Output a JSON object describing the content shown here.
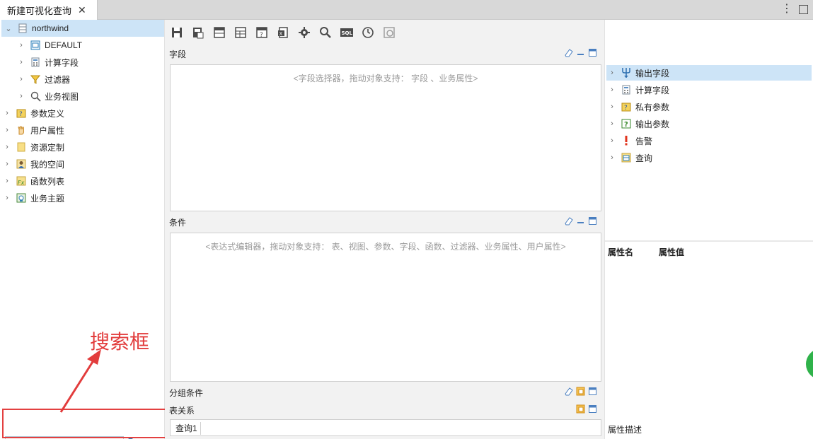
{
  "tabs": [
    {
      "label": "新建可视化查询",
      "close": "✕"
    }
  ],
  "window_controls": {
    "menu": "⋮"
  },
  "left_tree": {
    "root": {
      "label": "northwind",
      "icon": "database-icon"
    },
    "children": [
      {
        "label": "DEFAULT",
        "icon": "table-icon"
      },
      {
        "label": "计算字段",
        "icon": "calculator-icon"
      },
      {
        "label": "过滤器",
        "icon": "filter-icon"
      },
      {
        "label": "业务视图",
        "icon": "search-view-icon"
      }
    ],
    "top_level": [
      {
        "label": "参数定义",
        "icon": "parameter-icon"
      },
      {
        "label": "用户属性",
        "icon": "user-attribute-icon"
      },
      {
        "label": "资源定制",
        "icon": "folder-icon"
      },
      {
        "label": "我的空间",
        "icon": "user-space-icon"
      },
      {
        "label": "函数列表",
        "icon": "function-icon"
      },
      {
        "label": "业务主题",
        "icon": "business-theme-icon"
      }
    ]
  },
  "search": {
    "value": "",
    "placeholder": ""
  },
  "annotation": {
    "text": "搜索框",
    "color": "#e23c3c"
  },
  "toolbar": [
    "save-icon",
    "save-as-icon",
    "layout-icon",
    "table-layout-icon",
    "parameter-layout-icon",
    "export-excel-icon",
    "settings-icon",
    "search-icon",
    "sql-icon",
    "clock-icon",
    "cache-icon"
  ],
  "sections": {
    "fields": {
      "title": "字段",
      "placeholder": "<字段选择器，拖动对象支持： 字段 、业务属性>"
    },
    "conditions": {
      "title": "条件",
      "placeholder": "<表达式编辑器，拖动对象支持： 表、视图、参数、字段、函数、过滤器、业务属性、用户属性>"
    },
    "group": {
      "title": "分组条件"
    },
    "relations": {
      "title": "表关系"
    }
  },
  "query_tab": {
    "label": "查询1"
  },
  "right_tree": [
    {
      "label": "输出字段",
      "icon": "output-field-icon",
      "selected": true
    },
    {
      "label": "计算字段",
      "icon": "calculator-icon",
      "selected": false
    },
    {
      "label": "私有参数",
      "icon": "parameter-icon",
      "selected": false
    },
    {
      "label": "输出参数",
      "icon": "output-parameter-icon",
      "selected": false
    },
    {
      "label": "告警",
      "icon": "alert-icon",
      "selected": false
    },
    {
      "label": "查询",
      "icon": "query-icon",
      "selected": false
    }
  ],
  "properties": {
    "name_col": "属性名",
    "value_col": "属性值",
    "description": "属性描述"
  },
  "colors": {
    "selection": "#cde4f7",
    "annotation": "#e23c3c",
    "center_bg": "#f2f2f2"
  }
}
